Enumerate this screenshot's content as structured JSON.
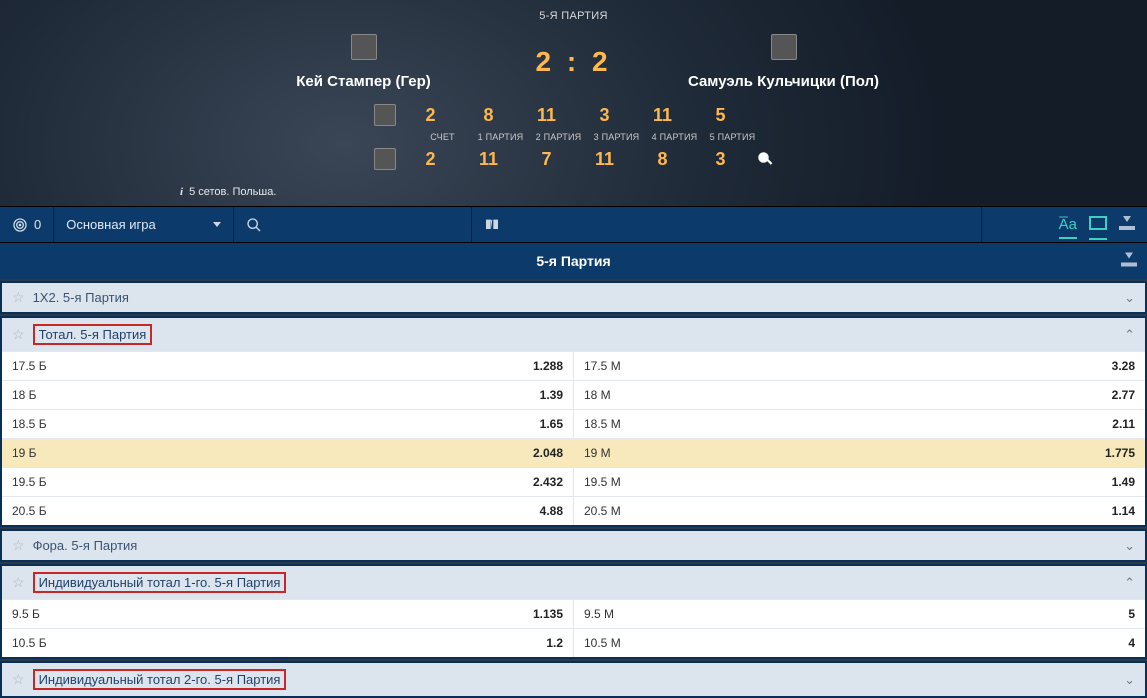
{
  "hero": {
    "game_label": "5-Я ПАРТИЯ",
    "player1": "Кей Стампер (Гер)",
    "player2": "Самуэль Кульчицки (Пол)",
    "main_score": "2 : 2",
    "columns": [
      "СЧЕТ",
      "1 ПАРТИЯ",
      "2 ПАРТИЯ",
      "3 ПАРТИЯ",
      "4 ПАРТИЯ",
      "5 ПАРТИЯ"
    ],
    "row1": [
      "2",
      "8",
      "11",
      "3",
      "11",
      "5"
    ],
    "row2": [
      "2",
      "11",
      "7",
      "11",
      "8",
      "3"
    ],
    "info": "5 сетов. Польша."
  },
  "toolbar": {
    "target_count": "0",
    "dropdown": "Основная игра"
  },
  "section_title": "5-я Партия",
  "markets": {
    "m1": {
      "title": "1X2. 5-я Партия"
    },
    "m2": {
      "title": "Тотал. 5-я Партия",
      "rows": [
        {
          "l": "17.5 Б",
          "lv": "1.288",
          "r": "17.5 М",
          "rv": "3.28",
          "hl": false
        },
        {
          "l": "18 Б",
          "lv": "1.39",
          "r": "18 М",
          "rv": "2.77",
          "hl": false
        },
        {
          "l": "18.5 Б",
          "lv": "1.65",
          "r": "18.5 М",
          "rv": "2.11",
          "hl": false
        },
        {
          "l": "19 Б",
          "lv": "2.048",
          "r": "19 М",
          "rv": "1.775",
          "hl": true
        },
        {
          "l": "19.5 Б",
          "lv": "2.432",
          "r": "19.5 М",
          "rv": "1.49",
          "hl": false
        },
        {
          "l": "20.5 Б",
          "lv": "4.88",
          "r": "20.5 М",
          "rv": "1.14",
          "hl": false
        }
      ]
    },
    "m3": {
      "title": "Фора. 5-я Партия"
    },
    "m4": {
      "title": "Индивидуальный тотал 1-го. 5-я Партия",
      "rows": [
        {
          "l": "9.5 Б",
          "lv": "1.135",
          "r": "9.5 М",
          "rv": "5",
          "hl": false
        },
        {
          "l": "10.5 Б",
          "lv": "1.2",
          "r": "10.5 М",
          "rv": "4",
          "hl": false
        }
      ]
    },
    "m5": {
      "title": "Индивидуальный тотал 2-го. 5-я Партия"
    }
  }
}
